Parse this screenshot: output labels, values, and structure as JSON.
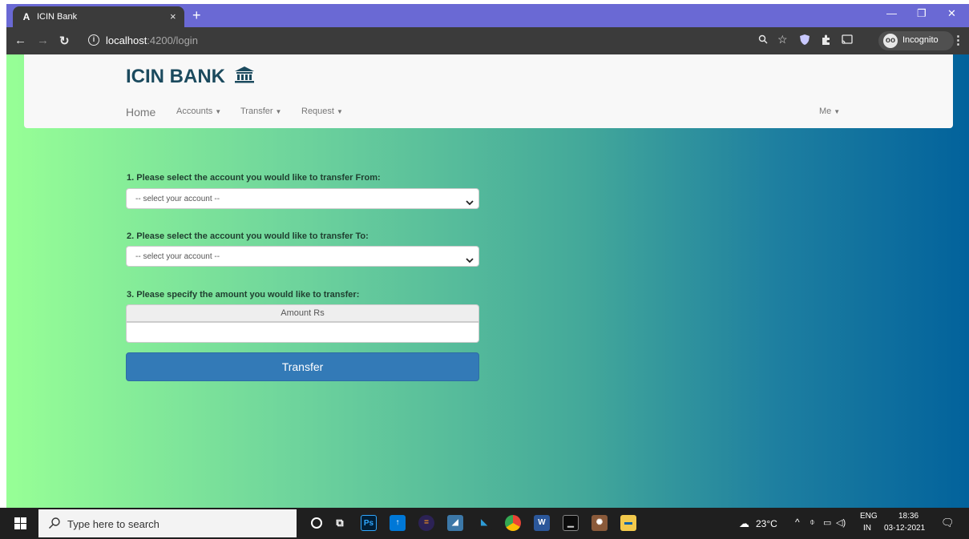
{
  "browser": {
    "tab": {
      "favicon": "A",
      "title": "ICIN Bank",
      "close": "×"
    },
    "new_tab": "+",
    "window_controls": {
      "minimize": "—",
      "restore": "❐",
      "close": "✕"
    },
    "address": {
      "host": "localhost",
      "path": ":4200/login"
    },
    "incognito_label": "Incognito",
    "incognito_icon": "incognito-icon",
    "menu": "⋮"
  },
  "app": {
    "brand": "ICIN BANK",
    "brand_icon": "bank-icon",
    "nav": {
      "home": "Home",
      "accounts": "Accounts",
      "transfer": "Transfer",
      "request": "Request",
      "me": "Me"
    },
    "form": {
      "from_label": "1. Please select the account you would like to transfer From:",
      "from_placeholder": "-- select your account --",
      "to_label": "2. Please select the account you would like to transfer To:",
      "to_placeholder": "-- select your account --",
      "amount_label": "3. Please specify the amount you would like to transfer:",
      "amount_addon": "Amount Rs",
      "amount_value": "",
      "submit": "Transfer"
    }
  },
  "taskbar": {
    "search_placeholder": "Type here to search",
    "weather": "23°C",
    "lang_top": "ENG",
    "lang_bottom": "IN",
    "time": "18:36",
    "date": "03-12-2021"
  },
  "colors": {
    "gradient_start": "#97ff96",
    "gradient_end": "#02629c",
    "brand": "#1b4a5e",
    "button": "#337ab7",
    "titlebar": "#6a69d4"
  }
}
